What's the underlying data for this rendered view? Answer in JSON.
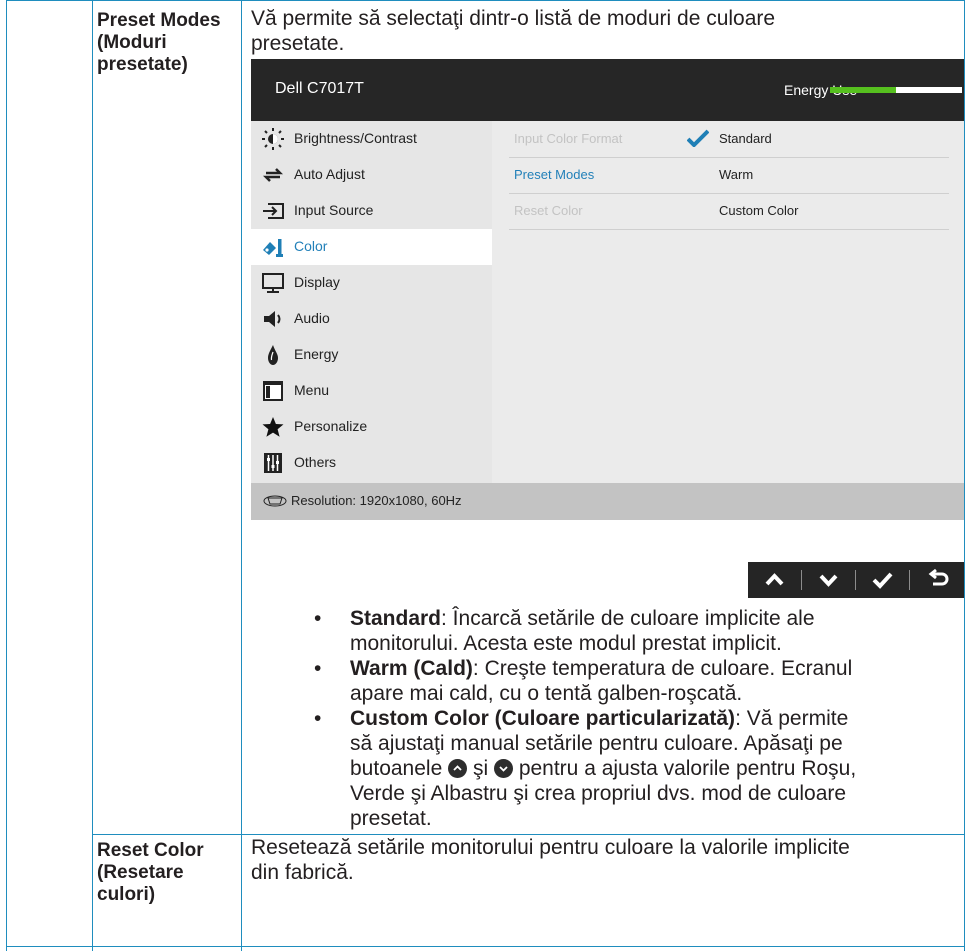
{
  "rows": [
    {
      "label_lines": [
        "Preset Modes",
        "(Moduri",
        "presetate)"
      ],
      "desc_lines": [
        "Vă permite să selectaţi dintr-o listă de moduri de culoare",
        "presetate."
      ]
    },
    {
      "label_lines": [
        "Reset Color",
        "(Resetare",
        "culori)"
      ],
      "desc_lines": [
        "Resetează setările monitorului pentru culoare la valorile implicite",
        "din fabrică."
      ]
    }
  ],
  "osd": {
    "title": "Dell C7017T",
    "energy_label": "Energy Use",
    "energy_level": 0.5,
    "accent_color": "#56c01f",
    "menu": [
      {
        "label": "Brightness/Contrast",
        "icon": "brightness-icon"
      },
      {
        "label": "Auto Adjust",
        "icon": "auto-adjust-icon"
      },
      {
        "label": "Input Source",
        "icon": "input-source-icon"
      },
      {
        "label": "Color",
        "icon": "color-icon",
        "active": true
      },
      {
        "label": "Display",
        "icon": "display-icon"
      },
      {
        "label": "Audio",
        "icon": "audio-icon"
      },
      {
        "label": "Energy",
        "icon": "energy-icon"
      },
      {
        "label": "Menu",
        "icon": "menu-icon"
      },
      {
        "label": "Personalize",
        "icon": "star-icon"
      },
      {
        "label": "Others",
        "icon": "others-icon"
      }
    ],
    "sub_items": [
      {
        "label": "Input Color Format",
        "value": "Standard",
        "checked": true
      },
      {
        "label": "Preset Modes",
        "value": "Warm",
        "active": true
      },
      {
        "label": "Reset Color",
        "value": "Custom Color"
      }
    ],
    "footer": "Resolution: 1920x1080, 60Hz"
  },
  "nav_buttons": [
    "up-arrow-icon",
    "down-arrow-icon",
    "checkmark-icon",
    "back-icon"
  ],
  "bullets": {
    "b1": {
      "bold": "Standard",
      "text_lines": [
        ": Încarcă setările de culoare implicite ale",
        "monitorului. Acesta este modul prestat implicit."
      ]
    },
    "b2": {
      "bold": "Warm (Cald)",
      "text_lines": [
        ": Creşte temperatura de culoare. Ecranul",
        "apare mai cald, cu o tentă galben-roşcată."
      ]
    },
    "b3": {
      "bold": "Custom Color (Culoare particularizată)",
      "line1_rest": ": Vă permite",
      "line2": "să ajustaţi manual setările pentru culoare. Apăsaţi pe",
      "line3_a": "butoanele",
      "line3_b": "şi",
      "line3_c": "pentru a ajusta valorile pentru Roşu,",
      "line4": "Verde şi Albastru şi crea propriul dvs. mod de culoare",
      "line5": "presetat."
    }
  },
  "bullet_char": "•"
}
